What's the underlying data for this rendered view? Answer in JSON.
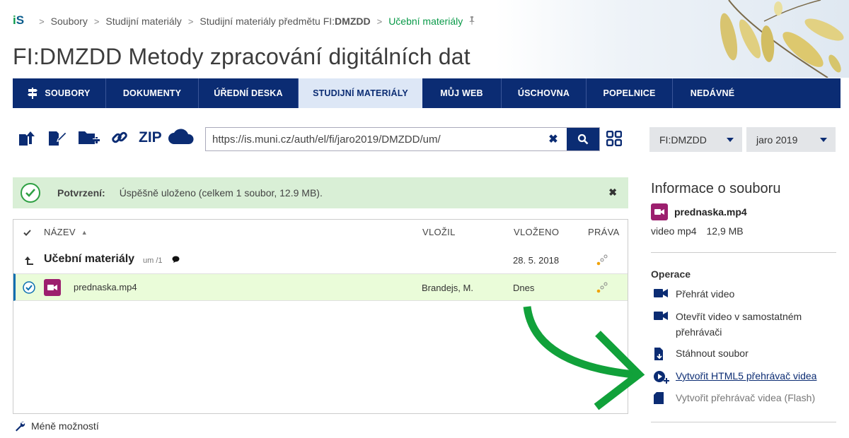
{
  "breadcrumb": {
    "logo": "iS",
    "items": [
      "Soubory",
      "Studijní materiály",
      "Studijní materiály předmětu FI:",
      "Učební materiály"
    ],
    "course_code_bold": "DMZDD"
  },
  "page_title": "FI:DMZDD Metody zpracování digitálních dat",
  "nav": {
    "items": [
      "SOUBORY",
      "DOKUMENTY",
      "ÚŘEDNÍ DESKA",
      "STUDIJNÍ MATERIÁLY",
      "MŮJ WEB",
      "ÚSCHOVNA",
      "POPELNICE",
      "NEDÁVNÉ"
    ],
    "active": "STUDIJNÍ MATERIÁLY"
  },
  "toolbar": {
    "zip_label": "ZIP",
    "url": "https://is.muni.cz/auth/el/fi/jaro2019/DMZDD/um/",
    "course_select": "FI:DMZDD",
    "term_select": "jaro 2019"
  },
  "alert": {
    "label": "Potvrzení:",
    "text": "Úspěšně uloženo (celkem 1 soubor, 12.9 MB)."
  },
  "table": {
    "headers": {
      "name": "NÁZEV",
      "uploaded_by": "VLOŽIL",
      "uploaded": "VLOŽENO",
      "rights": "PRÁVA"
    },
    "parent": {
      "name": "Učební materiály",
      "path": "um /1",
      "date": "28. 5. 2018"
    },
    "files": [
      {
        "name": "prednaska.mp4",
        "uploaded_by": "Brandejs, M.",
        "uploaded": "Dnes"
      }
    ]
  },
  "less_options": "Méně možností",
  "info": {
    "title": "Informace o souboru",
    "file_name": "prednaska.mp4",
    "file_type": "video mp4",
    "file_size": "12,9 MB",
    "operations_title": "Operace",
    "operations": [
      {
        "label": "Přehrát video"
      },
      {
        "label": "Otevřít video v samostatném přehrávači"
      },
      {
        "label": "Stáhnout soubor"
      },
      {
        "label": "Vytvořit HTML5 přehrávač videa"
      },
      {
        "label": "Vytvořit přehrávač videa (Flash)"
      }
    ]
  },
  "colors": {
    "nav_bg": "#0b2c73",
    "nav_active_bg": "#dde7f6",
    "accent_green": "#0a9a49",
    "alert_bg": "#d9efd6",
    "selected_row_bg": "#eafcd9",
    "video_icon": "#9c1f6e",
    "arrow_green": "#11a13a"
  }
}
